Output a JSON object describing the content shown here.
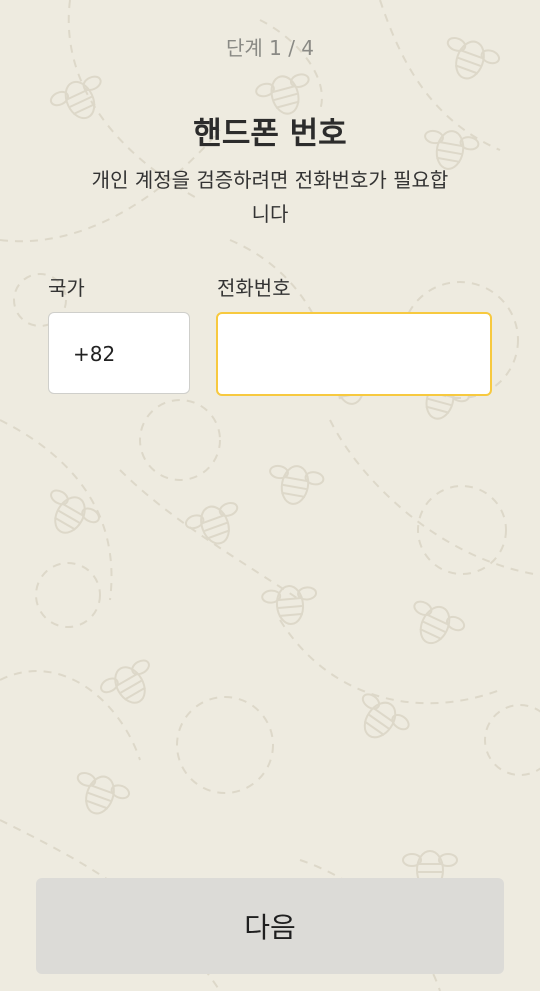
{
  "header": {
    "step_text": "단계 1 / 4"
  },
  "main": {
    "title": "핸드폰 번호",
    "subtitle": "개인 계정을 검증하려면 전화번호가 필요합니다",
    "country": {
      "label": "국가",
      "value": "+82"
    },
    "phone": {
      "label": "전화번호",
      "value": "",
      "placeholder": ""
    }
  },
  "footer": {
    "next_label": "다음"
  },
  "colors": {
    "background": "#eeebe0",
    "focus_border": "#f7c93f",
    "button_bg": "#dcdbd7",
    "pattern": "#ddd8c9"
  },
  "background_pattern": "bee-icons-with-dashed-paths"
}
